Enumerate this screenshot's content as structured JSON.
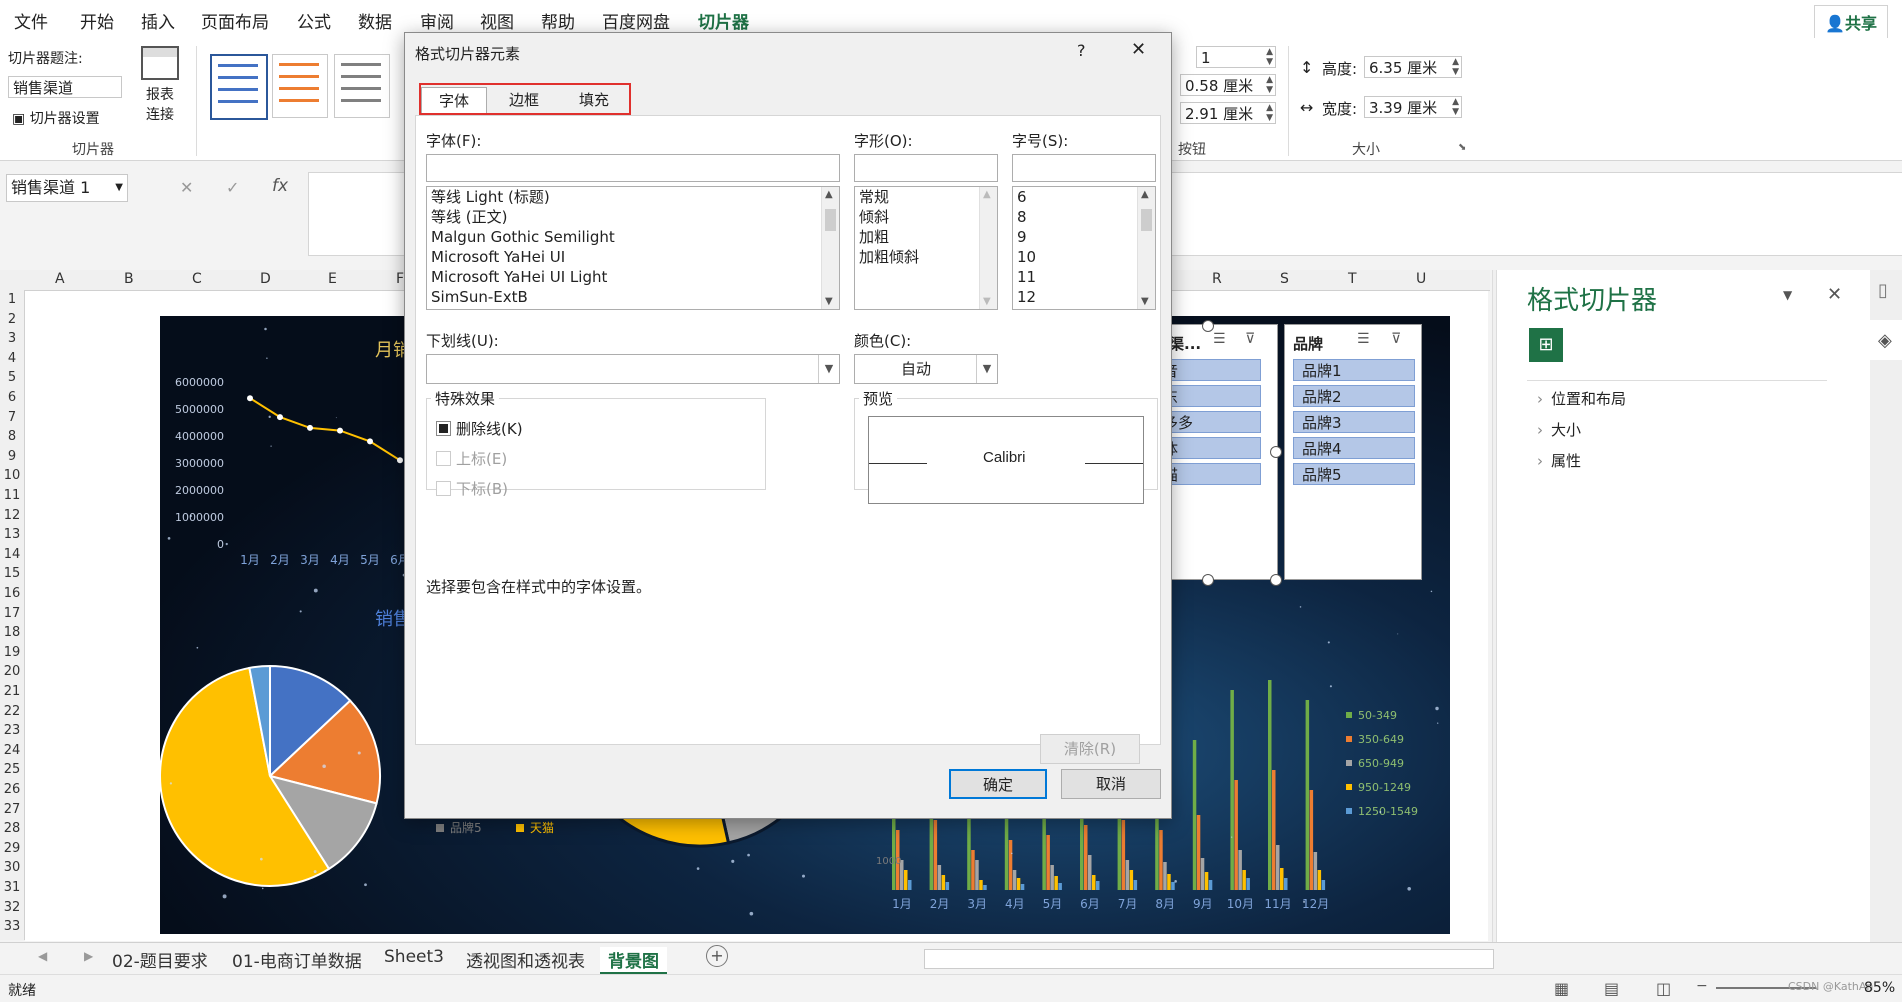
{
  "menu": {
    "items": [
      "文件",
      "开始",
      "插入",
      "页面布局",
      "公式",
      "数据",
      "审阅",
      "视图",
      "帮助",
      "百度网盘",
      "切片器"
    ],
    "share": "共享"
  },
  "ribbon": {
    "slicer_caption_label": "切片器题注:",
    "slicer_caption_value": "销售渠道",
    "slicer_settings": "切片器设置",
    "report_connections": "报表\n连接",
    "group_slicer": "切片器",
    "columns_value": "1",
    "btn_height_value": "0.58 厘米",
    "btn_width_value": "2.91 厘米",
    "group_buttons": "按钮",
    "height_label": "高度:",
    "height_value": "6.35 厘米",
    "width_label": "宽度:",
    "width_value": "3.39 厘米",
    "group_size": "大小"
  },
  "formula_bar": {
    "name_box": "销售渠道 1",
    "fx": "fx"
  },
  "grid": {
    "columns": [
      "A",
      "B",
      "C",
      "D",
      "E",
      "F",
      "R",
      "S",
      "T",
      "U"
    ],
    "rows": [
      "1",
      "2",
      "3",
      "4",
      "5",
      "6",
      "7",
      "8",
      "9",
      "10",
      "11",
      "12",
      "13",
      "14",
      "15",
      "16",
      "17",
      "18",
      "19",
      "20",
      "21",
      "22",
      "23",
      "24",
      "25",
      "26",
      "27",
      "28",
      "29",
      "30",
      "31",
      "32",
      "33"
    ]
  },
  "chart": {
    "line_title_partial": "月销",
    "y_ticks": [
      "6000000",
      "5000000",
      "4000000",
      "3000000",
      "2000000",
      "1000000",
      "0"
    ],
    "x_ticks": [
      "1月",
      "2月",
      "3月",
      "4月",
      "5月",
      "6月"
    ],
    "pie_title": "销售额",
    "legend_items": [
      "品牌5",
      "天猫"
    ],
    "bar_legend": [
      "50-349",
      "350-649",
      "650-949",
      "950-1249",
      "1250-1549"
    ],
    "bar_months": [
      "1月",
      "2月",
      "3月",
      "4月",
      "5月",
      "6月",
      "7月",
      "8月",
      "9月",
      "10月",
      "11月",
      "12月"
    ],
    "bar_tick": "1000",
    "colors": {
      "blue": "#4472c4",
      "orange": "#ed7d31",
      "gray": "#a5a5a5",
      "yellow": "#ffc000",
      "lightblue": "#5b9bd5",
      "green": "#70ad47"
    }
  },
  "chart_data": {
    "type": "line",
    "categories": [
      "1月",
      "2月",
      "3月",
      "4月",
      "5月",
      "6月"
    ],
    "series": [
      {
        "values": [
          5400000,
          4700000,
          4300000,
          4200000,
          3800000,
          3100000
        ]
      }
    ],
    "ylim": [
      0,
      6000000
    ]
  },
  "slicers": [
    {
      "header": "销售渠...",
      "items": [
        "抖音",
        "京东",
        "拼多多",
        "实体",
        "天猫"
      ]
    },
    {
      "header": "品牌",
      "items": [
        "品牌1",
        "品牌2",
        "品牌3",
        "品牌4",
        "品牌5"
      ]
    }
  ],
  "pane": {
    "title": "格式切片器",
    "sections": [
      "位置和布局",
      "大小",
      "属性"
    ]
  },
  "sheets": {
    "tabs": [
      "02-题目要求",
      "01-电商订单数据",
      "Sheet3",
      "透视图和透视表",
      "背景图"
    ],
    "active": "背景图"
  },
  "status": {
    "ready": "就绪",
    "zoom": "85%",
    "watermark": "CSDN @KathAn"
  },
  "dialog": {
    "title": "格式切片器元素",
    "help": "?",
    "close": "✕",
    "tabs": [
      "字体",
      "边框",
      "填充"
    ],
    "font_label": "字体(F):",
    "font_list": [
      "等线 Light (标题)",
      "等线 (正文)",
      "Malgun Gothic Semilight",
      "Microsoft YaHei UI",
      "Microsoft YaHei UI Light",
      "SimSun-ExtB"
    ],
    "style_label": "字形(O):",
    "style_list": [
      "常规",
      "倾斜",
      "加粗",
      "加粗倾斜"
    ],
    "size_label": "字号(S):",
    "size_list": [
      "6",
      "8",
      "9",
      "10",
      "11",
      "12"
    ],
    "underline_label": "下划线(U):",
    "color_label": "颜色(C):",
    "color_value": "自动",
    "effects_legend": "特殊效果",
    "strike": "删除线(K)",
    "superscript": "上标(E)",
    "subscript": "下标(B)",
    "preview_legend": "预览",
    "preview_text": "Calibri",
    "hint": "选择要包含在样式中的字体设置。",
    "clear": "清除(R)",
    "ok": "确定",
    "cancel": "取消"
  }
}
